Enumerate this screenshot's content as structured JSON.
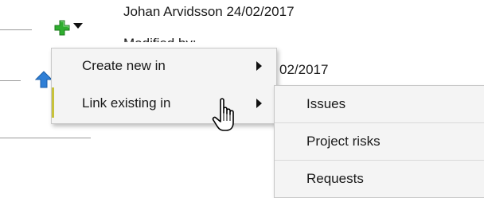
{
  "background": {
    "row1_text": "Johan Arvidsson 24/02/2017",
    "row2_text": "Modified by:",
    "row3_text": "02/2017"
  },
  "icons": {
    "add": "green-plus-icon",
    "dropdown": "caret-down-icon",
    "up": "blue-arrow-up-icon",
    "cursor": "hand-pointer-cursor"
  },
  "context_menu": {
    "items": [
      {
        "label": "Create new in",
        "has_submenu": true
      },
      {
        "label": "Link existing in",
        "has_submenu": true,
        "active": true
      }
    ]
  },
  "submenu": {
    "items": [
      {
        "label": "Issues"
      },
      {
        "label": "Project risks"
      },
      {
        "label": "Requests"
      }
    ]
  },
  "colors": {
    "menu_bg": "#f4f4f4",
    "active_marker": "#c7c23a",
    "plus_green": "#2fae2f",
    "arrow_blue": "#2f7fd6"
  }
}
